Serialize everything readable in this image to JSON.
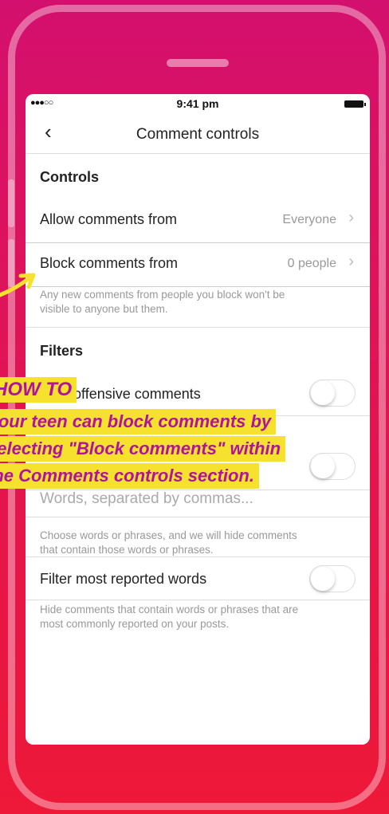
{
  "status_bar": {
    "signal": "●●●○○",
    "time": "9:41 pm"
  },
  "nav": {
    "back_glyph": "‹",
    "title": "Comment controls"
  },
  "controls": {
    "section_title": "Controls",
    "allow": {
      "label": "Allow comments from",
      "value": "Everyone"
    },
    "block": {
      "label": "Block comments from",
      "value": "0 people"
    },
    "block_helper": "Any new comments from people you block won't be visible to anyone but them."
  },
  "filters": {
    "section_title": "Filters",
    "offensive_label": "Hide offensive comments",
    "offensive_on": false,
    "keyword_on": false,
    "words_placeholder": "Words, separated by commas...",
    "words_helper": "Choose words or phrases, and we will hide comments that contain those words or phrases.",
    "reported_label": "Filter most reported words",
    "reported_on": false,
    "reported_helper": "Hide comments that contain words or phrases that are most commonly reported on your posts."
  },
  "overlay": {
    "title": "HOW TO",
    "line1": "Your teen can block comments by",
    "line2": "selecting \"Block comments\" within",
    "line3": "the Comments controls section."
  },
  "colors": {
    "overlay_bg": "#f7e12f",
    "overlay_text": "#b0139e",
    "arrow": "#f7e12f"
  }
}
